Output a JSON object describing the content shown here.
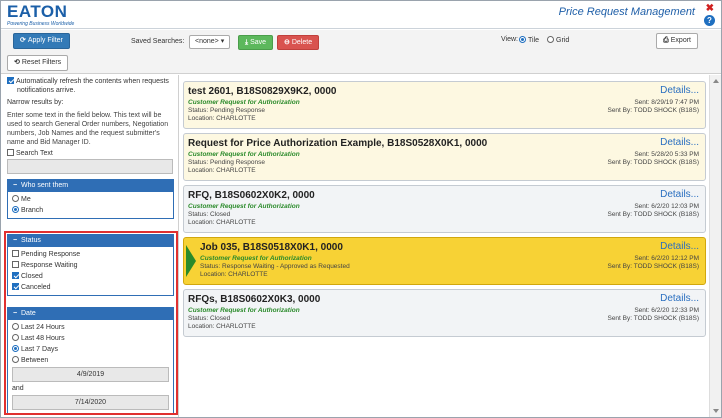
{
  "header": {
    "logo": "EATON",
    "tagline": "Powering Business Worldwide",
    "app_title": "Price Request Management",
    "close_glyph": "✖",
    "help_glyph": "?"
  },
  "toolbar": {
    "apply_filter": "Apply Filter",
    "reset_filters": "Reset Filters",
    "saved_searches_label": "Saved Searches:",
    "saved_search_value": "<none>",
    "save": "Save",
    "delete": "Delete",
    "view_label": "View:",
    "view_options": [
      "Tile",
      "Grid"
    ],
    "view_selected": "Tile",
    "export": "Export"
  },
  "filters": {
    "auto_refresh_label": "Automatically refresh the contents when requests notifications arrive.",
    "auto_refresh_checked": true,
    "narrow_label": "Narrow results by:",
    "help_text": "Enter some text in the field below. This text will be used to search General Order numbers, Negotiation numbers, Job Names and the request submitter's name and Bid Manager ID.",
    "search_text_label": "Search Text",
    "search_text_value": "",
    "who_sent": {
      "title": "Who sent them",
      "options": [
        "Me",
        "Branch"
      ],
      "selected": "Branch"
    },
    "status": {
      "title": "Status",
      "options": [
        {
          "label": "Pending Response",
          "checked": false
        },
        {
          "label": "Response Waiting",
          "checked": false
        },
        {
          "label": "Closed",
          "checked": true
        },
        {
          "label": "Canceled",
          "checked": true
        }
      ]
    },
    "date": {
      "title": "Date",
      "options": [
        "Last 24 Hours",
        "Last 48 Hours",
        "Last 7 Days",
        "Between"
      ],
      "selected": "Last 7 Days",
      "from": "4/9/2019",
      "and_label": "and",
      "to": "7/14/2020"
    }
  },
  "results": [
    {
      "title": "test 2601, B18S0829X9K2, 0000",
      "sub": "Customer Request for Authorization",
      "status": "Status: Pending Response",
      "location": "Location: CHARLOTTE",
      "details": "Details...",
      "sent": "Sent: 8/29/19 7:47 PM",
      "sent_by": "Sent By: TODD SHOCK (B18S)",
      "style": "cream"
    },
    {
      "title": "Request for Price Authorization Example, B18S0528X0K1, 0000",
      "sub": "Customer Request for Authorization",
      "status": "Status: Pending Response",
      "location": "Location: CHARLOTTE",
      "details": "Details...",
      "sent": "Sent: 5/28/20 5:33 PM",
      "sent_by": "Sent By: TODD SHOCK (B18S)",
      "style": "cream"
    },
    {
      "title": "RFQ, B18S0602X0K2, 0000",
      "sub": "Customer Request for Authorization",
      "status": "Status: Closed",
      "location": "Location: CHARLOTTE",
      "details": "Details...",
      "sent": "Sent: 6/2/20 12:03 PM",
      "sent_by": "Sent By: TODD SHOCK (B18S)",
      "style": "grey"
    },
    {
      "title": "Job 035, B18S0518X0K1, 0000",
      "sub": "Customer Request for Authorization",
      "status": "Status: Response Waiting - Approved as Requested",
      "location": "Location: CHARLOTTE",
      "details": "Details...",
      "sent": "Sent: 6/2/20 12:12 PM",
      "sent_by": "Sent By: TODD SHOCK (B18S)",
      "style": "active"
    },
    {
      "title": "RFQs, B18S0602X0K3, 0000",
      "sub": "Customer Request for Authorization",
      "status": "Status: Closed",
      "location": "Location: CHARLOTTE",
      "details": "Details...",
      "sent": "Sent: 6/2/20 12:33 PM",
      "sent_by": "Sent By: TODD SHOCK (B18S)",
      "style": "grey"
    }
  ]
}
